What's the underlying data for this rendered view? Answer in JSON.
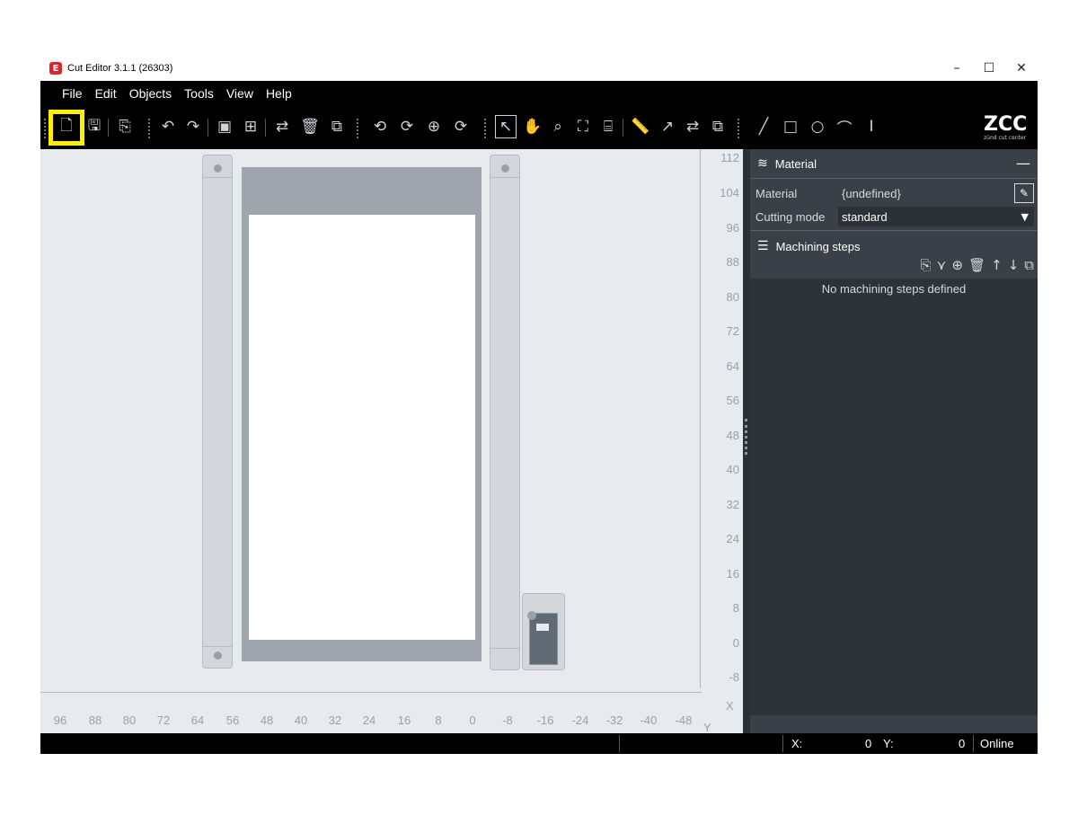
{
  "window": {
    "title": "Cut Editor 3.1.1 (26303)",
    "app_icon": "E"
  },
  "window_controls": {
    "minimize": "–",
    "maximize": "☐",
    "close": "✕"
  },
  "menu": [
    "File",
    "Edit",
    "Objects",
    "Tools",
    "View",
    "Help"
  ],
  "toolbar": {
    "icons": [
      "new-file-icon",
      "save-icon",
      "export-icon",
      "undo-icon",
      "redo-icon",
      "group-icon",
      "ungroup-icon",
      "swap-icon",
      "delete-icon",
      "frame-icon",
      "rotate-left-icon",
      "rotate-right-icon",
      "stamp-icon",
      "rotate-shape-icon",
      "pointer-icon",
      "hand-icon",
      "zoom-icon",
      "fit-icon",
      "fit-table-icon",
      "measure-icon",
      "arrow-icon",
      "swap-direction-icon",
      "copy-icon",
      "line-icon",
      "rectangle-icon",
      "circle-icon",
      "arc-icon",
      "text-icon"
    ],
    "highlight_color": "#ffee00",
    "logo_main": "ZCC",
    "logo_sub": "zünd cut center"
  },
  "ruler": {
    "y_labels": [
      "112",
      "104",
      "96",
      "88",
      "80",
      "72",
      "64",
      "56",
      "48",
      "40",
      "32",
      "24",
      "16",
      "8",
      "0",
      "-8"
    ],
    "x_labels": [
      "96",
      "88",
      "80",
      "72",
      "64",
      "56",
      "48",
      "40",
      "32",
      "24",
      "16",
      "8",
      "0",
      "-8",
      "-16",
      "-24",
      "-32",
      "-40",
      "-48"
    ],
    "x_axis_name": "X",
    "y_axis_name": "Y"
  },
  "panel": {
    "material_header": "Material",
    "collapse": "—",
    "material_label": "Material",
    "material_value": "{undefined}",
    "cutting_mode_label": "Cutting mode",
    "cutting_mode_value": "standard",
    "steps_header": "Machining steps",
    "empty_message": "No machining steps defined"
  },
  "status": {
    "x_label": "X:",
    "x_value": "0",
    "y_label": "Y:",
    "y_value": "0",
    "connection": "Online"
  },
  "colors": {
    "accent": "#d9262b",
    "canvas_bg": "#e8ebee",
    "panel_bg": "#3a4047",
    "toolbar_bg": "#000000"
  }
}
